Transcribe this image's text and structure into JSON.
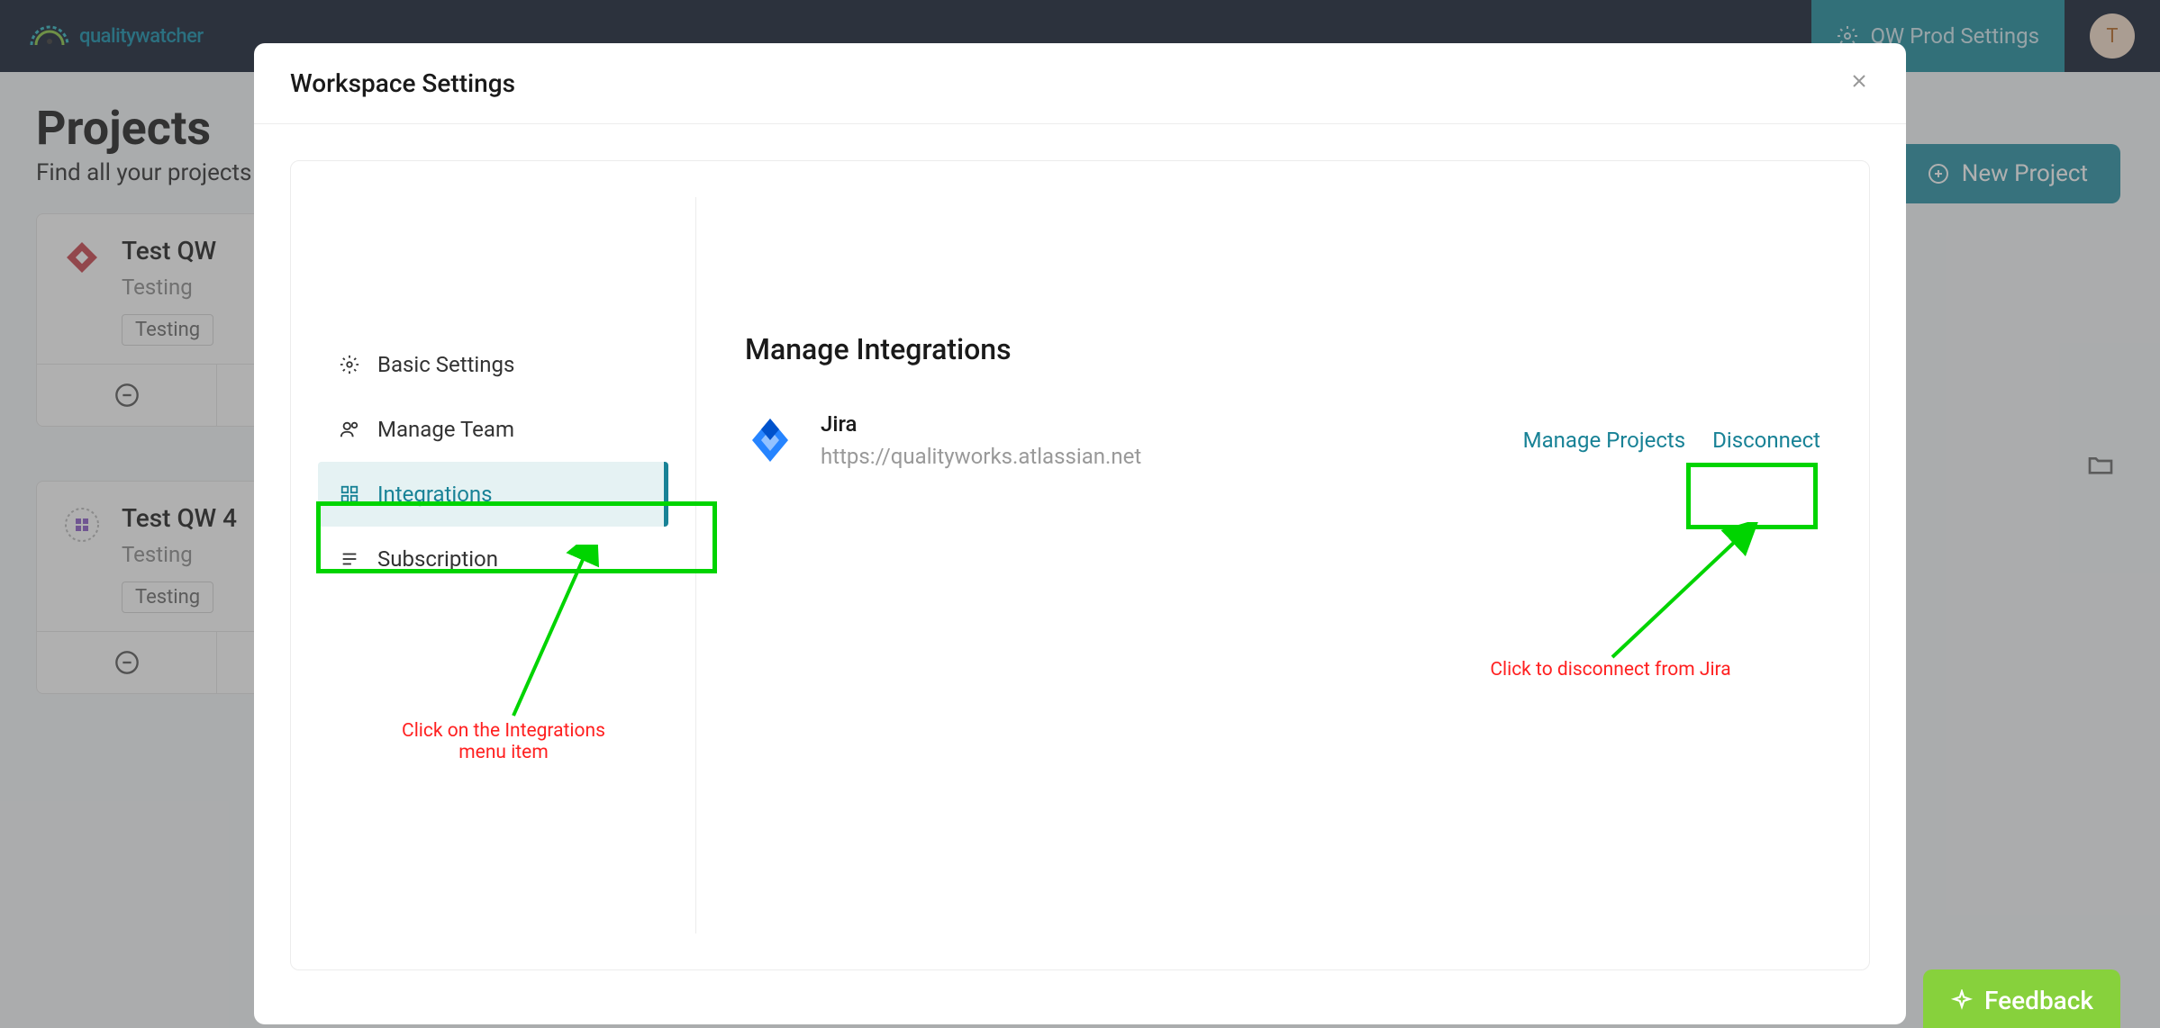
{
  "nav": {
    "brand": "qualitywatcher",
    "settings_label": "QW Prod Settings",
    "avatar_initial": "T"
  },
  "page": {
    "title": "Projects",
    "subtitle": "Find all your projects",
    "new_project_label": "New Project"
  },
  "projects": [
    {
      "name": "Test QW",
      "desc": "Testing",
      "tag": "Testing"
    },
    {
      "name": "Test QW 4",
      "desc": "Testing",
      "tag": "Testing"
    }
  ],
  "modal": {
    "title": "Workspace Settings",
    "sidebar": {
      "items": [
        {
          "label": "Basic Settings"
        },
        {
          "label": "Manage Team"
        },
        {
          "label": "Integrations"
        },
        {
          "label": "Subscription"
        }
      ]
    },
    "content": {
      "title": "Manage Integrations",
      "integration": {
        "name": "Jira",
        "url": "https://qualityworks.atlassian.net",
        "manage_label": "Manage Projects",
        "disconnect_label": "Disconnect"
      }
    }
  },
  "annotations": {
    "integrations_hint": "Click on the Integrations menu item",
    "disconnect_hint": "Click to disconnect from Jira"
  },
  "feedback": {
    "label": "Feedback"
  }
}
